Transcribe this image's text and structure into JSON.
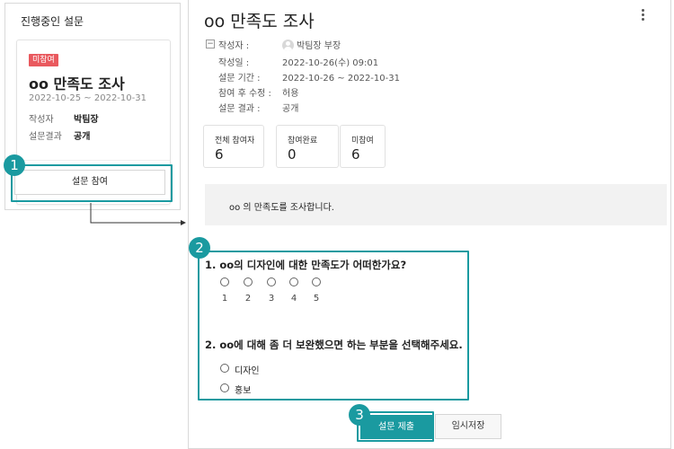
{
  "left_panel": {
    "title": "진행중인 설문",
    "card": {
      "badge": "미참여",
      "title": "oo 만족도 조사",
      "dates": "2022-10-25 ~ 2022-10-31",
      "author_label": "작성자",
      "author_value": "박팀장",
      "result_label": "설문결과",
      "result_value": "공개"
    },
    "join_button_label": "설문 참여"
  },
  "survey": {
    "title": "oo 만족도 조사",
    "collapse_symbol": "−",
    "meta": {
      "author_label": "작성자 :",
      "author_value": "박팀장 부장",
      "created_label": "작성일 :",
      "created_value": "2022-10-26(수) 09:01",
      "period_label": "설문 기간 :",
      "period_value": "2022-10-26 ~ 2022-10-31",
      "edit_label": "참여 후 수정 :",
      "edit_value": "허용",
      "result_label": "설문 결과 :",
      "result_value": "공개"
    },
    "stats": [
      {
        "label": "전체 참여자",
        "value": "6"
      },
      {
        "label": "참여완료",
        "value": "0"
      },
      {
        "label": "미참여",
        "value": "6"
      }
    ],
    "description": "oo 의 만족도를 조사합니다.",
    "q1": {
      "title": "1. oo의 디자인에 대한 만족도가 어떠한가요?",
      "scale": [
        "1",
        "2",
        "3",
        "4",
        "5"
      ]
    },
    "q2": {
      "title": "2. oo에 대해 좀 더 보완했으면 하는 부분을 선택해주세요.",
      "options": [
        "디자인",
        "홍보"
      ]
    },
    "submit_label": "설문 제출",
    "save_label": "임시저장"
  },
  "annotations": {
    "step1": "1",
    "step2": "2",
    "step3": "3"
  },
  "colors": {
    "accent": "#1a9aa0",
    "badge": "#e9595e"
  }
}
